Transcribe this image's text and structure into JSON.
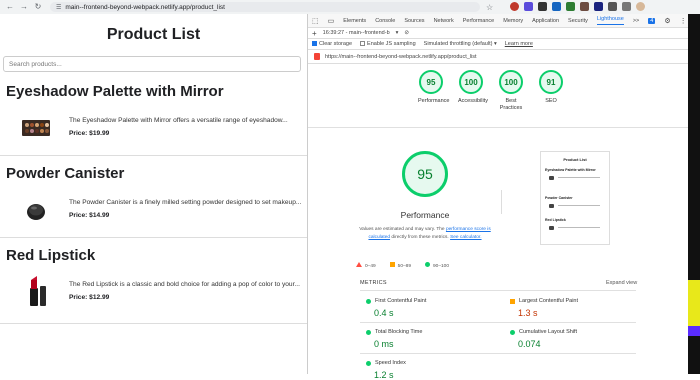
{
  "browser": {
    "url": "main--frontend-beyond-webpack.netlify.app/product_list"
  },
  "page": {
    "title": "Product List",
    "search_placeholder": "Search products...",
    "products": [
      {
        "name": "Eyeshadow Palette with Mirror",
        "description": "The Eyeshadow Palette with Mirror offers a versatile range of eyeshadow...",
        "price": "Price: $19.99"
      },
      {
        "name": "Powder Canister",
        "description": "The Powder Canister is a finely milled setting powder designed to set makeup...",
        "price": "Price: $14.99"
      },
      {
        "name": "Red Lipstick",
        "description": "The Red Lipstick is a classic and bold choice for adding a pop of color to your...",
        "price": "Price: $12.99"
      }
    ]
  },
  "devtools": {
    "tabs": [
      "Elements",
      "Console",
      "Sources",
      "Network",
      "Performance",
      "Memory",
      "Application",
      "Security",
      "Lighthouse",
      ">>"
    ],
    "active_tab": "Lighthouse",
    "badge": "4",
    "report_time": "16:39:27 - main--frontend-b",
    "options": {
      "clear_storage": "Clear storage",
      "js_sampling": "Enable JS sampling",
      "throttling": "Simulated throttling (default)",
      "learn_more": "Learn more"
    },
    "report_url": "https://main--frontend-beyond-webpack.netlify.app/product_list",
    "scores": [
      {
        "label": "Performance",
        "value": "95"
      },
      {
        "label": "Accessibility",
        "value": "100"
      },
      {
        "label": "Best Practices",
        "value": "100"
      },
      {
        "label": "SEO",
        "value": "91"
      }
    ],
    "performance": {
      "score": "95",
      "title": "Performance",
      "note_pre": "Values are estimated and may vary. The",
      "note_link1": "performance score is calculated",
      "note_mid": "directly from these metrics.",
      "note_link2": "See calculator."
    },
    "legend": [
      "0–49",
      "50–89",
      "90–100"
    ],
    "thumbnail": {
      "title": "Product List",
      "items": [
        "Eyeshadow Palette with Mirror",
        "Powder Canister",
        "Red Lipstick"
      ]
    },
    "metrics_header": "METRICS",
    "expand_view": "Expand view",
    "metrics": [
      {
        "label": "First Contentful Paint",
        "value": "0.4 s",
        "status": "good"
      },
      {
        "label": "Largest Contentful Paint",
        "value": "1.3 s",
        "status": "average"
      },
      {
        "label": "Total Blocking Time",
        "value": "0 ms",
        "status": "good"
      },
      {
        "label": "Cumulative Layout Shift",
        "value": "0.074",
        "status": "good"
      },
      {
        "label": "Speed Index",
        "value": "1.2 s",
        "status": "good"
      }
    ],
    "colors": {
      "good": "#0cce6b",
      "average": "#ffa400",
      "poor": "#ff4e42",
      "link": "#1a73e8"
    }
  }
}
